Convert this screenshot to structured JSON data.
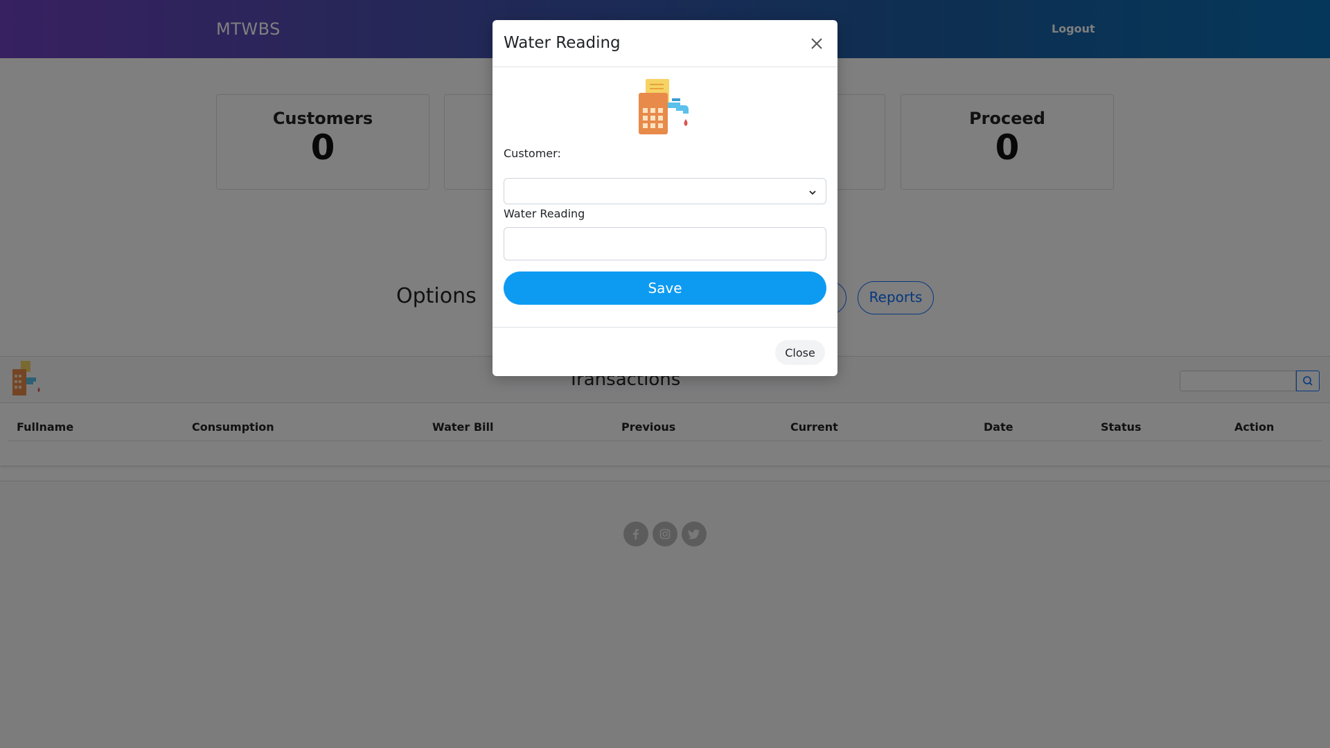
{
  "navbar": {
    "brand": "MTWBS",
    "logout_label": "Logout"
  },
  "stats": [
    {
      "label": "Customers",
      "value": "0"
    },
    {
      "label": "Proceed",
      "value": "0"
    }
  ],
  "options": {
    "title": "Options",
    "reports_label": "Reports"
  },
  "transactions": {
    "title": "Transactions",
    "search_placeholder": "",
    "columns": [
      "Fullname",
      "Consumption",
      "Water Bill",
      "Previous",
      "Current",
      "Date",
      "Status",
      "Action"
    ]
  },
  "footer": {
    "social_icons": [
      "facebook-icon",
      "instagram-icon",
      "twitter-icon"
    ]
  },
  "modal": {
    "title": "Water Reading",
    "customer_label": "Customer:",
    "customer_value": "",
    "reading_label": "Water Reading",
    "reading_value": "",
    "save_label": "Save",
    "close_label": "Close"
  },
  "colors": {
    "nav_gradient_start": "#6f42c1",
    "nav_gradient_end": "#0a6fb5",
    "primary": "#0d6efd",
    "save_button": "#0d9bf2",
    "backdrop": "rgba(0,0,0,0.5)"
  }
}
